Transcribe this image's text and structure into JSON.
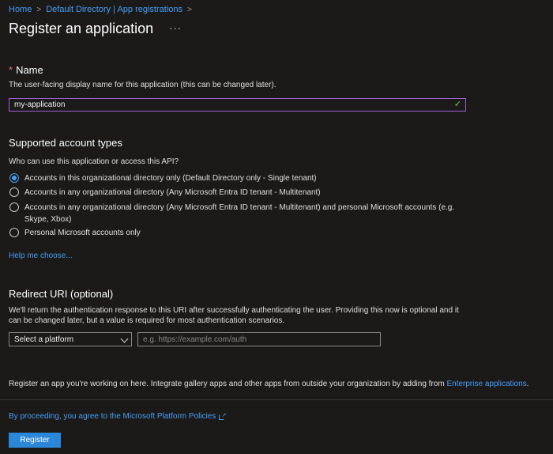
{
  "breadcrumb": {
    "items": [
      "Home",
      "Default Directory | App registrations"
    ]
  },
  "header": {
    "title": "Register an application",
    "more_label": "···"
  },
  "name_section": {
    "title": "Name",
    "required_marker": "*",
    "description": "The user-facing display name for this application (this can be changed later).",
    "value": "my-application"
  },
  "account_types": {
    "title": "Supported account types",
    "question": "Who can use this application or access this API?",
    "options": [
      {
        "label": "Accounts in this organizational directory only (Default Directory only - Single tenant)",
        "selected": true
      },
      {
        "label": "Accounts in any organizational directory (Any Microsoft Entra ID tenant - Multitenant)",
        "selected": false
      },
      {
        "label": "Accounts in any organizational directory (Any Microsoft Entra ID tenant - Multitenant) and personal Microsoft accounts (e.g. Skype, Xbox)",
        "selected": false
      },
      {
        "label": "Personal Microsoft accounts only",
        "selected": false
      }
    ],
    "help_link": "Help me choose..."
  },
  "redirect": {
    "title": "Redirect URI (optional)",
    "description": "We'll return the authentication response to this URI after successfully authenticating the user. Providing this now is optional and it can be changed later, but a value is required for most authentication scenarios.",
    "platform_value": "Select a platform",
    "uri_placeholder": "e.g. https://example.com/auth"
  },
  "info": {
    "text": "Register an app you're working on here. Integrate gallery apps and other apps from outside your organization by adding from ",
    "link": "Enterprise applications",
    "suffix": "."
  },
  "footer": {
    "policy_link": "By proceeding, you agree to the Microsoft Platform Policies",
    "register_label": "Register"
  },
  "icons": {
    "breadcrumb_separator": "chevron-right-icon",
    "valid": "checkmark-icon",
    "dropdown": "chevron-down-icon",
    "external": "external-link-icon"
  },
  "colors": {
    "background": "#1b1a19",
    "link": "#479ef5",
    "primary_button": "#2b88d8",
    "focus_border": "#9e60d8",
    "valid_check": "#6ccb5f",
    "required": "#f1707b"
  }
}
